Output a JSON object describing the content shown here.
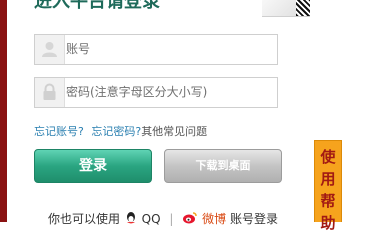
{
  "login": {
    "title": "进入平台请登录",
    "username_placeholder": "账号",
    "password_placeholder": "密码(注意字母区分大小写)",
    "links": {
      "forgot_account": "忘记账号?",
      "forgot_password": "忘记密码?",
      "faq": "其他常见问题"
    },
    "buttons": {
      "login": "登录",
      "download": "下载到桌面"
    },
    "help_tab": "使用帮助",
    "alt_login": {
      "prefix": "你也可以使用",
      "qq": "QQ",
      "separator": "|",
      "weibo": "微博",
      "suffix": "账号登录"
    }
  },
  "icons": [
    "user-icon",
    "lock-icon",
    "qq-icon",
    "weibo-icon"
  ],
  "colors": {
    "accent": "#2aa581",
    "title": "#1e6a5a",
    "link": "#2a7fb0",
    "help_tab": "#f6a31d",
    "left_bar": "#8a1212"
  }
}
